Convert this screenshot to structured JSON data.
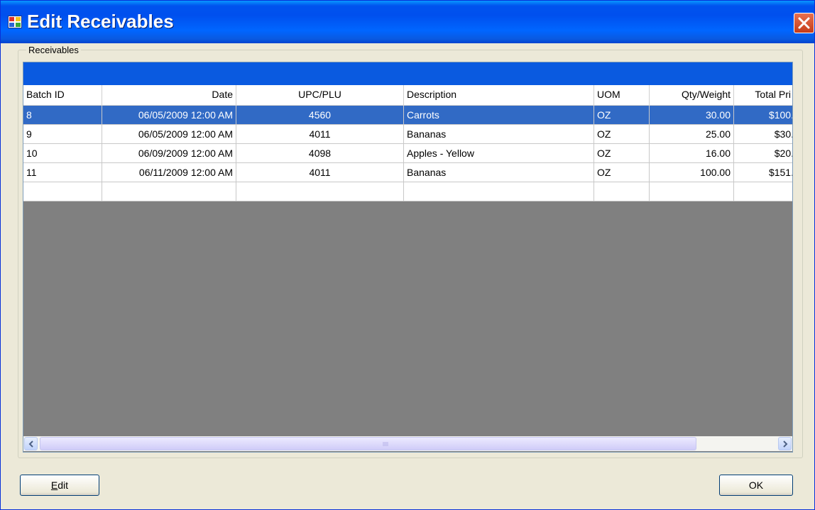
{
  "window": {
    "title": "Edit Receivables"
  },
  "group": {
    "label": "Receivables"
  },
  "grid": {
    "columns": [
      "Batch ID",
      "Date",
      "UPC/PLU",
      "Description",
      "UOM",
      "Qty/Weight",
      "Total Pri"
    ],
    "rows": [
      {
        "batch_id": "8",
        "date": "06/05/2009 12:00 AM",
        "upc": "4560",
        "description": "Carrots",
        "uom": "OZ",
        "qty": "30.00",
        "total": "$100.",
        "selected": true
      },
      {
        "batch_id": "9",
        "date": "06/05/2009 12:00 AM",
        "upc": "4011",
        "description": "Bananas",
        "uom": "OZ",
        "qty": "25.00",
        "total": "$30.",
        "selected": false
      },
      {
        "batch_id": "10",
        "date": "06/09/2009 12:00 AM",
        "upc": "4098",
        "description": "Apples - Yellow",
        "uom": "OZ",
        "qty": "16.00",
        "total": "$20.",
        "selected": false
      },
      {
        "batch_id": "11",
        "date": "06/11/2009 12:00 AM",
        "upc": "4011",
        "description": "Bananas",
        "uom": "OZ",
        "qty": "100.00",
        "total": "$151.",
        "selected": false
      },
      {
        "batch_id": "",
        "date": "",
        "upc": "",
        "description": "",
        "uom": "",
        "qty": "",
        "total": "",
        "selected": false
      }
    ]
  },
  "buttons": {
    "edit_label": "Edit",
    "edit_mnemonic": "E",
    "edit_rest": "dit",
    "ok_label": "OK"
  },
  "icons": {
    "app": "app-window-icon",
    "close": "close-icon",
    "scroll_left": "arrow-left-icon",
    "scroll_right": "arrow-right-icon",
    "grip": "scroll-grip-icon"
  },
  "colors": {
    "titlebar": "#0054e3",
    "selection": "#316ac5",
    "grid_background": "#808080",
    "close_button": "#d6502e"
  }
}
